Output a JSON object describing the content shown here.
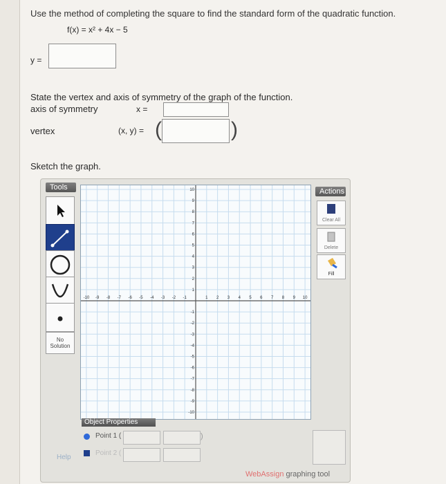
{
  "question": {
    "instruction": "Use the method of completing the square to find the standard form of the quadratic function.",
    "function": "f(x) = x² + 4x − 5",
    "answer_label": "y ="
  },
  "vertex_section": {
    "prompt": "State the vertex and axis of symmetry of the graph of the function.",
    "axis_label": "axis of symmetry",
    "axis_eq": "x =",
    "vertex_label": "vertex",
    "vertex_eq": "(x, y) =",
    "paren_open": "(",
    "paren_close": ")"
  },
  "sketch_label": "Sketch the graph.",
  "graph_tool": {
    "tools_header": "Tools",
    "actions_header": "Actions",
    "no_solution_label": "No Solution",
    "actions": {
      "clear_all": "Clear All",
      "delete": "Delete",
      "fill": "Fill"
    },
    "object_properties": "Object Properties",
    "point1": "Point 1 (",
    "point1_close": ")",
    "point2": "Point 2 (",
    "help": "Help",
    "brand": "WebAssign",
    "brand_suffix": "graphing tool",
    "x_ticks": [
      "-10",
      "-9",
      "-8",
      "-7",
      "-6",
      "-5",
      "-4",
      "-3",
      "-2",
      "-1",
      "1",
      "2",
      "3",
      "4",
      "5",
      "6",
      "7",
      "8",
      "9",
      "10"
    ],
    "y_ticks": [
      "10",
      "9",
      "8",
      "7",
      "6",
      "5",
      "4",
      "3",
      "2",
      "1",
      "-1",
      "-2",
      "-3",
      "-4",
      "-5",
      "-6",
      "-7",
      "-8",
      "-9",
      "-10"
    ],
    "colors": {
      "selected_tool": "#1f3f8c",
      "grid_line": "#c6dcee",
      "axis": "#555555",
      "point_color": "#2f69d9"
    }
  }
}
